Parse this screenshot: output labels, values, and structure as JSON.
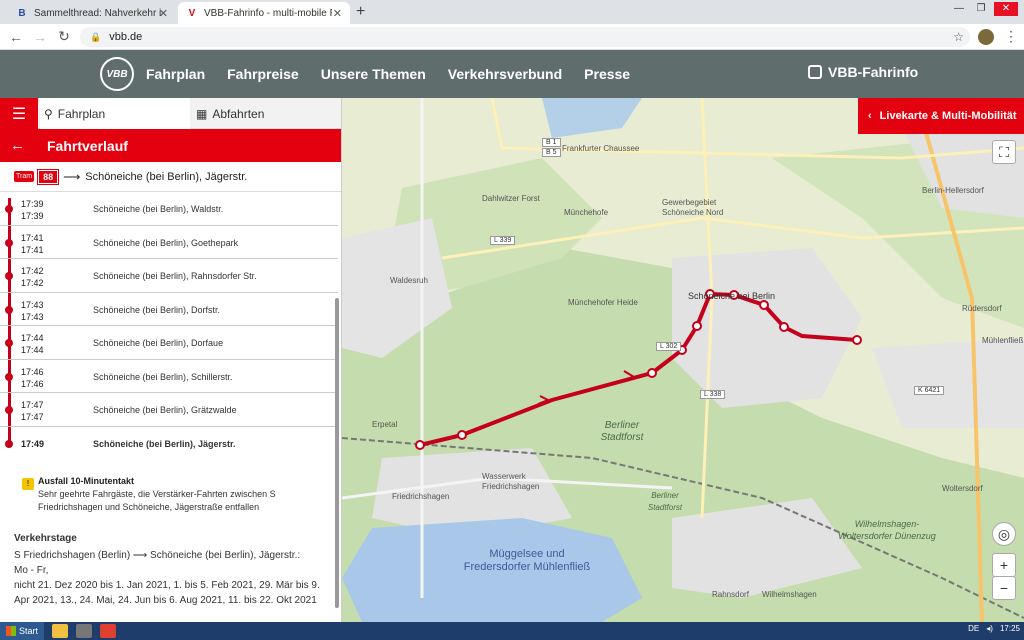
{
  "browser": {
    "tabs": [
      {
        "label": "Sammelthread: Nahverkehr in Bran",
        "favicon": "B"
      },
      {
        "label": "VBB-Fahrinfo - multi-mobile Fahrpl",
        "favicon": "V"
      }
    ],
    "url": "vbb.de"
  },
  "site": {
    "logo": "VBB",
    "nav": [
      "Fahrplan",
      "Fahrpreise",
      "Unsere Themen",
      "Verkehrsverbund",
      "Presse"
    ],
    "fahrinfo": "VBB-Fahrinfo"
  },
  "panel": {
    "tab_fahrplan": "Fahrplan",
    "tab_abfahrten": "Abfahrten",
    "header": "Fahrtverlauf",
    "line": {
      "mode": "Tram",
      "number": "88",
      "destination": "Schöneiche (bei Berlin), Jägerstr."
    },
    "stops": [
      {
        "arr": "17:39",
        "dep": "17:39",
        "name": "Schöneiche (bei Berlin), Waldstr."
      },
      {
        "arr": "17:41",
        "dep": "17:41",
        "name": "Schöneiche (bei Berlin), Goethepark"
      },
      {
        "arr": "17:42",
        "dep": "17:42",
        "name": "Schöneiche (bei Berlin), Rahnsdorfer Str."
      },
      {
        "arr": "17:43",
        "dep": "17:43",
        "name": "Schöneiche (bei Berlin), Dorfstr."
      },
      {
        "arr": "17:44",
        "dep": "17:44",
        "name": "Schöneiche (bei Berlin), Dorfaue"
      },
      {
        "arr": "17:46",
        "dep": "17:46",
        "name": "Schöneiche (bei Berlin), Schillerstr."
      },
      {
        "arr": "17:47",
        "dep": "17:47",
        "name": "Schöneiche (bei Berlin), Grätzwalde"
      },
      {
        "arr": "17:49",
        "dep": "",
        "name": "Schöneiche (bei Berlin), Jägerstr."
      }
    ],
    "notice": {
      "title": "Ausfall 10-Minutentakt",
      "text": "Sehr geehrte Fahrgäste, die Verstärker-Fahrten zwischen S Friedrichshagen und Schöneiche, Jägerstraße entfallen"
    },
    "verkehrstage": {
      "title": "Verkehrstage",
      "route": "S Friedrichshagen (Berlin) ⟶ Schöneiche (bei Berlin), Jägerstr.:",
      "days": "Mo - Fr,",
      "text": "nicht 21. Dez 2020 bis 1. Jan 2021, 1. bis 5. Feb 2021, 29. Mär bis 9. Apr 2021, 13., 24. Mai, 24. Jun bis 6. Aug 2021, 11. bis 22. Okt 2021"
    }
  },
  "map": {
    "livekarte": "Livekarte & Multi-Mobilität",
    "labels": {
      "muenchehofe": "Münchehofe",
      "waldesruh": "Waldesruh",
      "schoeneiche": "Schöneiche bei Berlin",
      "friedrichshagen": "Friedrichshagen",
      "rahnsdorf": "Rahnsdorf",
      "woltersdorf": "Woltersdorf",
      "ruedersdorf": "Rüdersdorf",
      "muehlenfliess": "Mühlenfließ",
      "hellersdorf": "Berlin-Hellersdorf",
      "stadtforst": "Berliner Stadtforst",
      "stadtforst2": "Berliner Stadtforst",
      "mueggelsee": "Müggelsee und Fredersdorfer Mühlenfließ",
      "wilhelmshagen": "Wilhelmshagen-Woltersdorfer Dünenzug",
      "gewerbe": "Gewerbegebiet Schöneiche Nord",
      "erpetal": "Erpetal",
      "wasserwerk": "Wasserwerk Friedrichshagen",
      "wilhelmshagen2": "Wilhelmshagen",
      "frankfurter": "Frankfurter Chaussee",
      "schoeneicheheide": "Münchehofer Heide",
      "dahlwitzer": "Dahlwitzer Forst"
    },
    "roads": [
      "B 1",
      "B 5",
      "L 339",
      "L 302",
      "L 338",
      "K 6421"
    ]
  },
  "taskbar": {
    "start": "Start",
    "lang": "DE",
    "time": "17:25"
  }
}
